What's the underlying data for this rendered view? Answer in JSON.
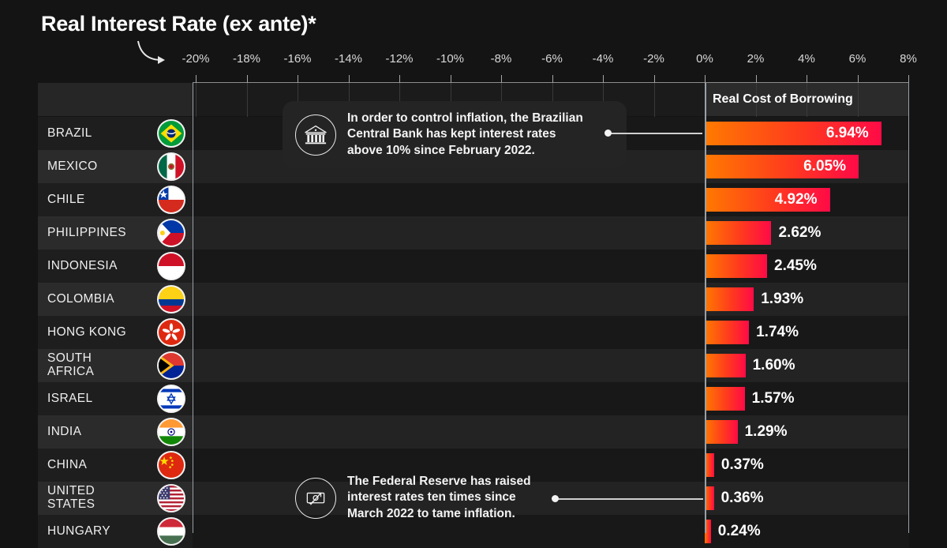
{
  "header": {
    "title": "Real Interest Rate (ex ante)*",
    "column_label": "Real Cost of Borrowing",
    "arrow_icon": "curved-arrow-icon"
  },
  "colors": {
    "background": "#141414",
    "bar_start": "#ff7a00",
    "bar_end": "#ff0a46",
    "gridline": "#3a3a3a",
    "axis": "#9aa0a6",
    "text": "#ffffff"
  },
  "chart_data": {
    "type": "bar",
    "title": "Real Interest Rate (ex ante)*",
    "xlabel": "Real Cost of Borrowing",
    "ylabel": "",
    "xlim": [
      -21,
      8.5
    ],
    "grid": true,
    "orientation": "horizontal",
    "tick_labels": [
      "-20%",
      "-18%",
      "-16%",
      "-14%",
      "-12%",
      "-10%",
      "-8%",
      "-6%",
      "-4%",
      "-2%",
      "0%",
      "2%",
      "4%",
      "6%",
      "8%"
    ],
    "tick_values": [
      -20,
      -18,
      -16,
      -14,
      -12,
      -10,
      -8,
      -6,
      -4,
      -2,
      0,
      2,
      4,
      6,
      8
    ],
    "categories": [
      "BRAZIL",
      "MEXICO",
      "CHILE",
      "PHILIPPINES",
      "INDONESIA",
      "COLOMBIA",
      "HONG KONG",
      "SOUTH AFRICA",
      "ISRAEL",
      "INDIA",
      "CHINA",
      "UNITED STATES",
      "HUNGARY"
    ],
    "values": [
      6.94,
      6.05,
      4.92,
      2.62,
      2.45,
      1.93,
      1.74,
      1.6,
      1.57,
      1.29,
      0.37,
      0.36,
      0.24
    ],
    "value_labels": [
      "6.94%",
      "6.05%",
      "4.92%",
      "2.62%",
      "2.45%",
      "1.93%",
      "1.74%",
      "1.60%",
      "1.57%",
      "1.29%",
      "0.37%",
      "0.36%",
      "0.24%"
    ]
  },
  "rows": [
    {
      "name": "BRAZIL",
      "lines": [
        "BRAZIL"
      ],
      "value_label": "6.94%",
      "value": 6.94,
      "flag": "flag-brazil"
    },
    {
      "name": "MEXICO",
      "lines": [
        "MEXICO"
      ],
      "value_label": "6.05%",
      "value": 6.05,
      "flag": "flag-mexico"
    },
    {
      "name": "CHILE",
      "lines": [
        "CHILE"
      ],
      "value_label": "4.92%",
      "value": 4.92,
      "flag": "flag-chile"
    },
    {
      "name": "PHILIPPINES",
      "lines": [
        "PHILIPPINES"
      ],
      "value_label": "2.62%",
      "value": 2.62,
      "flag": "flag-philippines"
    },
    {
      "name": "INDONESIA",
      "lines": [
        "INDONESIA"
      ],
      "value_label": "2.45%",
      "value": 2.45,
      "flag": "flag-indonesia"
    },
    {
      "name": "COLOMBIA",
      "lines": [
        "COLOMBIA"
      ],
      "value_label": "1.93%",
      "value": 1.93,
      "flag": "flag-colombia"
    },
    {
      "name": "HONG KONG",
      "lines": [
        "HONG KONG"
      ],
      "value_label": "1.74%",
      "value": 1.74,
      "flag": "flag-hongkong"
    },
    {
      "name": "SOUTH AFRICA",
      "lines": [
        "SOUTH",
        "AFRICA"
      ],
      "value_label": "1.60%",
      "value": 1.6,
      "flag": "flag-southafrica"
    },
    {
      "name": "ISRAEL",
      "lines": [
        "ISRAEL"
      ],
      "value_label": "1.57%",
      "value": 1.57,
      "flag": "flag-israel"
    },
    {
      "name": "INDIA",
      "lines": [
        "INDIA"
      ],
      "value_label": "1.29%",
      "value": 1.29,
      "flag": "flag-india"
    },
    {
      "name": "CHINA",
      "lines": [
        "CHINA"
      ],
      "value_label": "0.37%",
      "value": 0.37,
      "flag": "flag-china"
    },
    {
      "name": "UNITED STATES",
      "lines": [
        "UNITED",
        "STATES"
      ],
      "value_label": "0.36%",
      "value": 0.36,
      "flag": "flag-usa"
    },
    {
      "name": "HUNGARY",
      "lines": [
        "HUNGARY"
      ],
      "value_label": "0.24%",
      "value": 0.24,
      "flag": "flag-hungary"
    }
  ],
  "annotations": [
    {
      "id": "brazil-annotation",
      "icon": "bank-building-icon",
      "text": "In order to control inflation, the Brazilian\nCentral Bank has kept interest rates\nabove 10% since February 2022."
    },
    {
      "id": "fed-annotation",
      "icon": "banknote-arrow-icon",
      "text": "The Federal Reserve has raised\ninterest rates ten times since\nMarch 2022 to tame inflation."
    }
  ]
}
